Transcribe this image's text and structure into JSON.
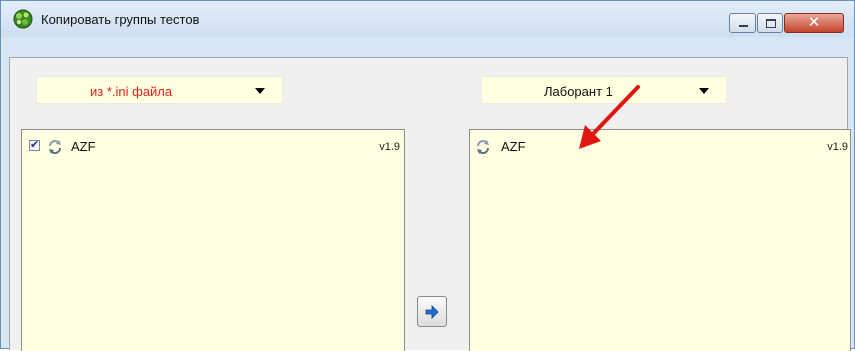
{
  "window": {
    "title": "Копировать группы тестов",
    "icon": "green-molecule-icon",
    "controls": [
      "minimize-icon",
      "maximize-icon",
      "close-icon"
    ],
    "close_glyph": "✕"
  },
  "source": {
    "combo_value": "из *.ini файла",
    "items": [
      {
        "checked": true,
        "checkmark": "✔",
        "name": "AZF",
        "version": "v1.9"
      }
    ]
  },
  "target": {
    "combo_value": "Лаборант 1",
    "items": [
      {
        "name": "AZF",
        "version": "v1.9"
      }
    ]
  },
  "actions": {
    "copy_button_icon": "arrow-right-icon"
  },
  "colors": {
    "source_combo_text": "#e0241b",
    "list_background": "#ffffe1",
    "annotation_arrow": "#e3150f",
    "copy_arrow": "#1c6fd6"
  }
}
